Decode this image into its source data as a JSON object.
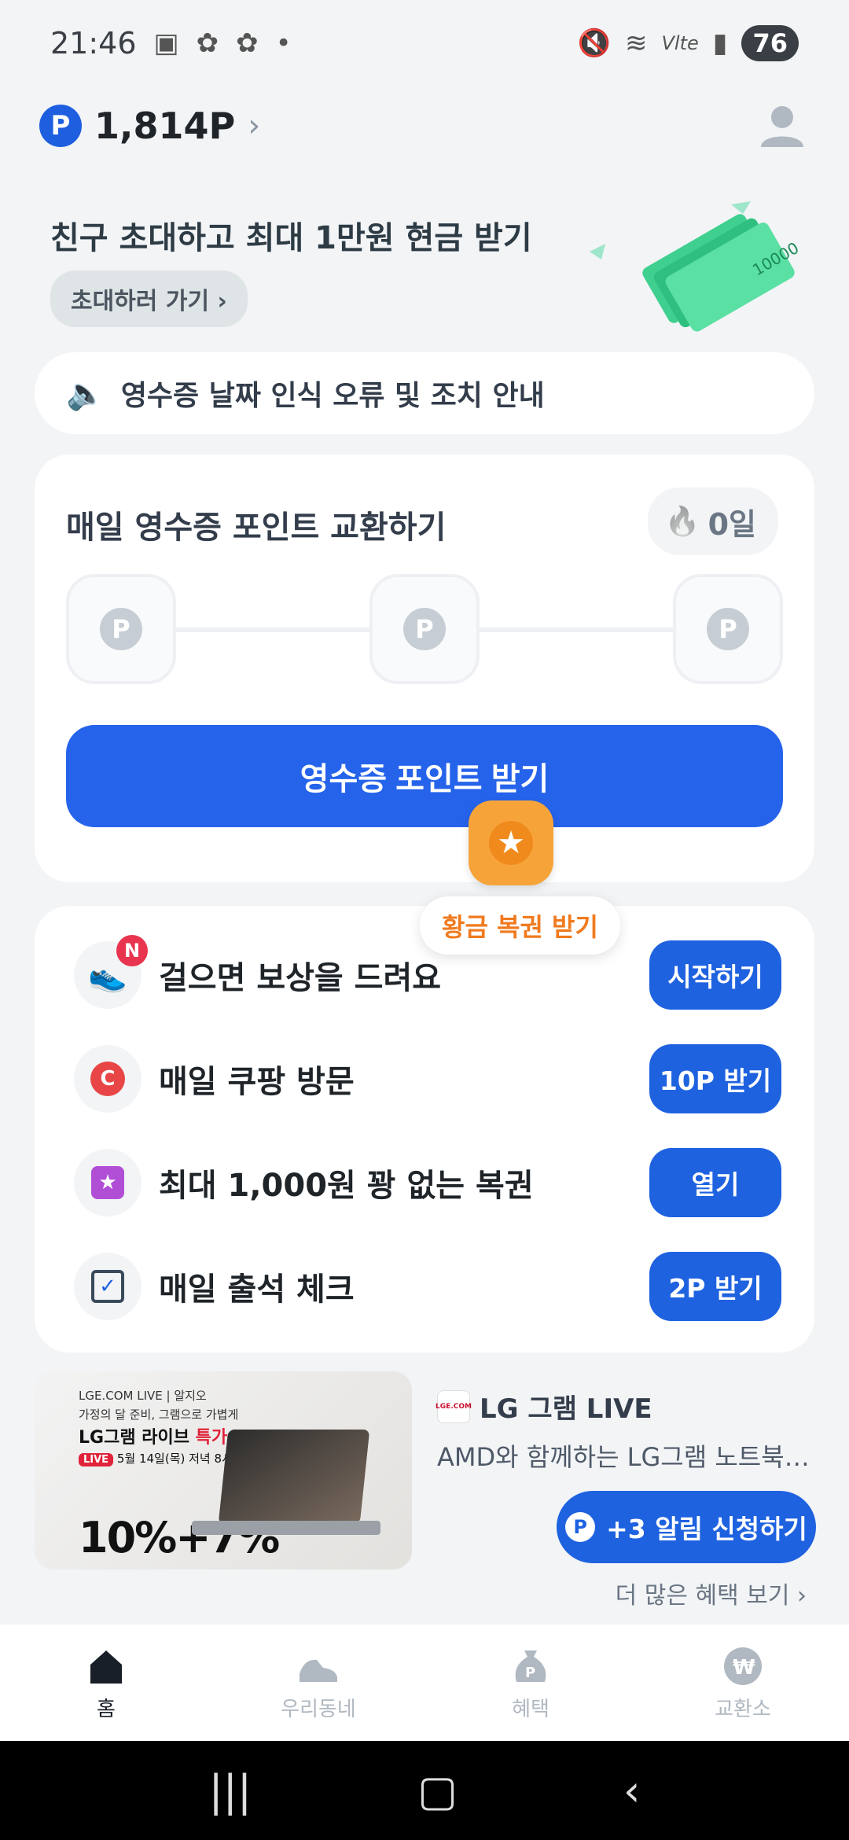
{
  "status": {
    "time": "21:46",
    "battery": "76",
    "network": "Vlte"
  },
  "header": {
    "points": "1,814P",
    "p_symbol": "P"
  },
  "invite": {
    "title": "친구 초대하고 최대 1만원 현금 받기",
    "button": "초대하러 가기 ›",
    "bill_value": "10000"
  },
  "notice": {
    "text": "영수증 날짜 인식 오류 및 조치 안내"
  },
  "receipt_card": {
    "title": "매일 영수증 포인트 교환하기",
    "streak": "0일",
    "step_symbol": "P",
    "button": "영수증 포인트 받기",
    "tooltip": "황금 복권 받기"
  },
  "tasks": [
    {
      "label": "걸으면 보상을 드려요",
      "button": "시작하기",
      "badge": "N"
    },
    {
      "label": "매일 쿠팡 방문",
      "button": "10P 받기",
      "icon_letter": "C"
    },
    {
      "label": "최대 1,000원 꽝 없는 복권",
      "button": "열기"
    },
    {
      "label": "매일 출석 체크",
      "button": "2P 받기"
    }
  ],
  "ad": {
    "thumb_top": "LGE.COM LIVE | 알지오",
    "thumb_sub": "가정의 달 준비, 그램으로 가볍게",
    "thumb_title": "LG그램 라이브 ",
    "thumb_title_accent": "특가",
    "thumb_live_badge": "LIVE",
    "thumb_date": "5월 14일(목) 저녁 8시",
    "thumb_discount": "10%+7%",
    "brand_logo": "LGE.COM",
    "brand": "LG 그램 LIVE",
    "desc": "AMD와 함께하는 LG그램 노트북 특...",
    "alarm_button": "+3 알림 신청하기",
    "more": "더 많은 혜택 보기 ›"
  },
  "nav": [
    {
      "label": "홈",
      "icon": "home-icon",
      "active": true
    },
    {
      "label": "우리동네",
      "icon": "sneaker-icon"
    },
    {
      "label": "혜택",
      "icon": "money-bag-icon"
    },
    {
      "label": "교환소",
      "icon": "won-icon"
    }
  ],
  "colors": {
    "primary": "#1e62e0",
    "accent_orange": "#f07a1e",
    "background": "#f2f4f6"
  }
}
